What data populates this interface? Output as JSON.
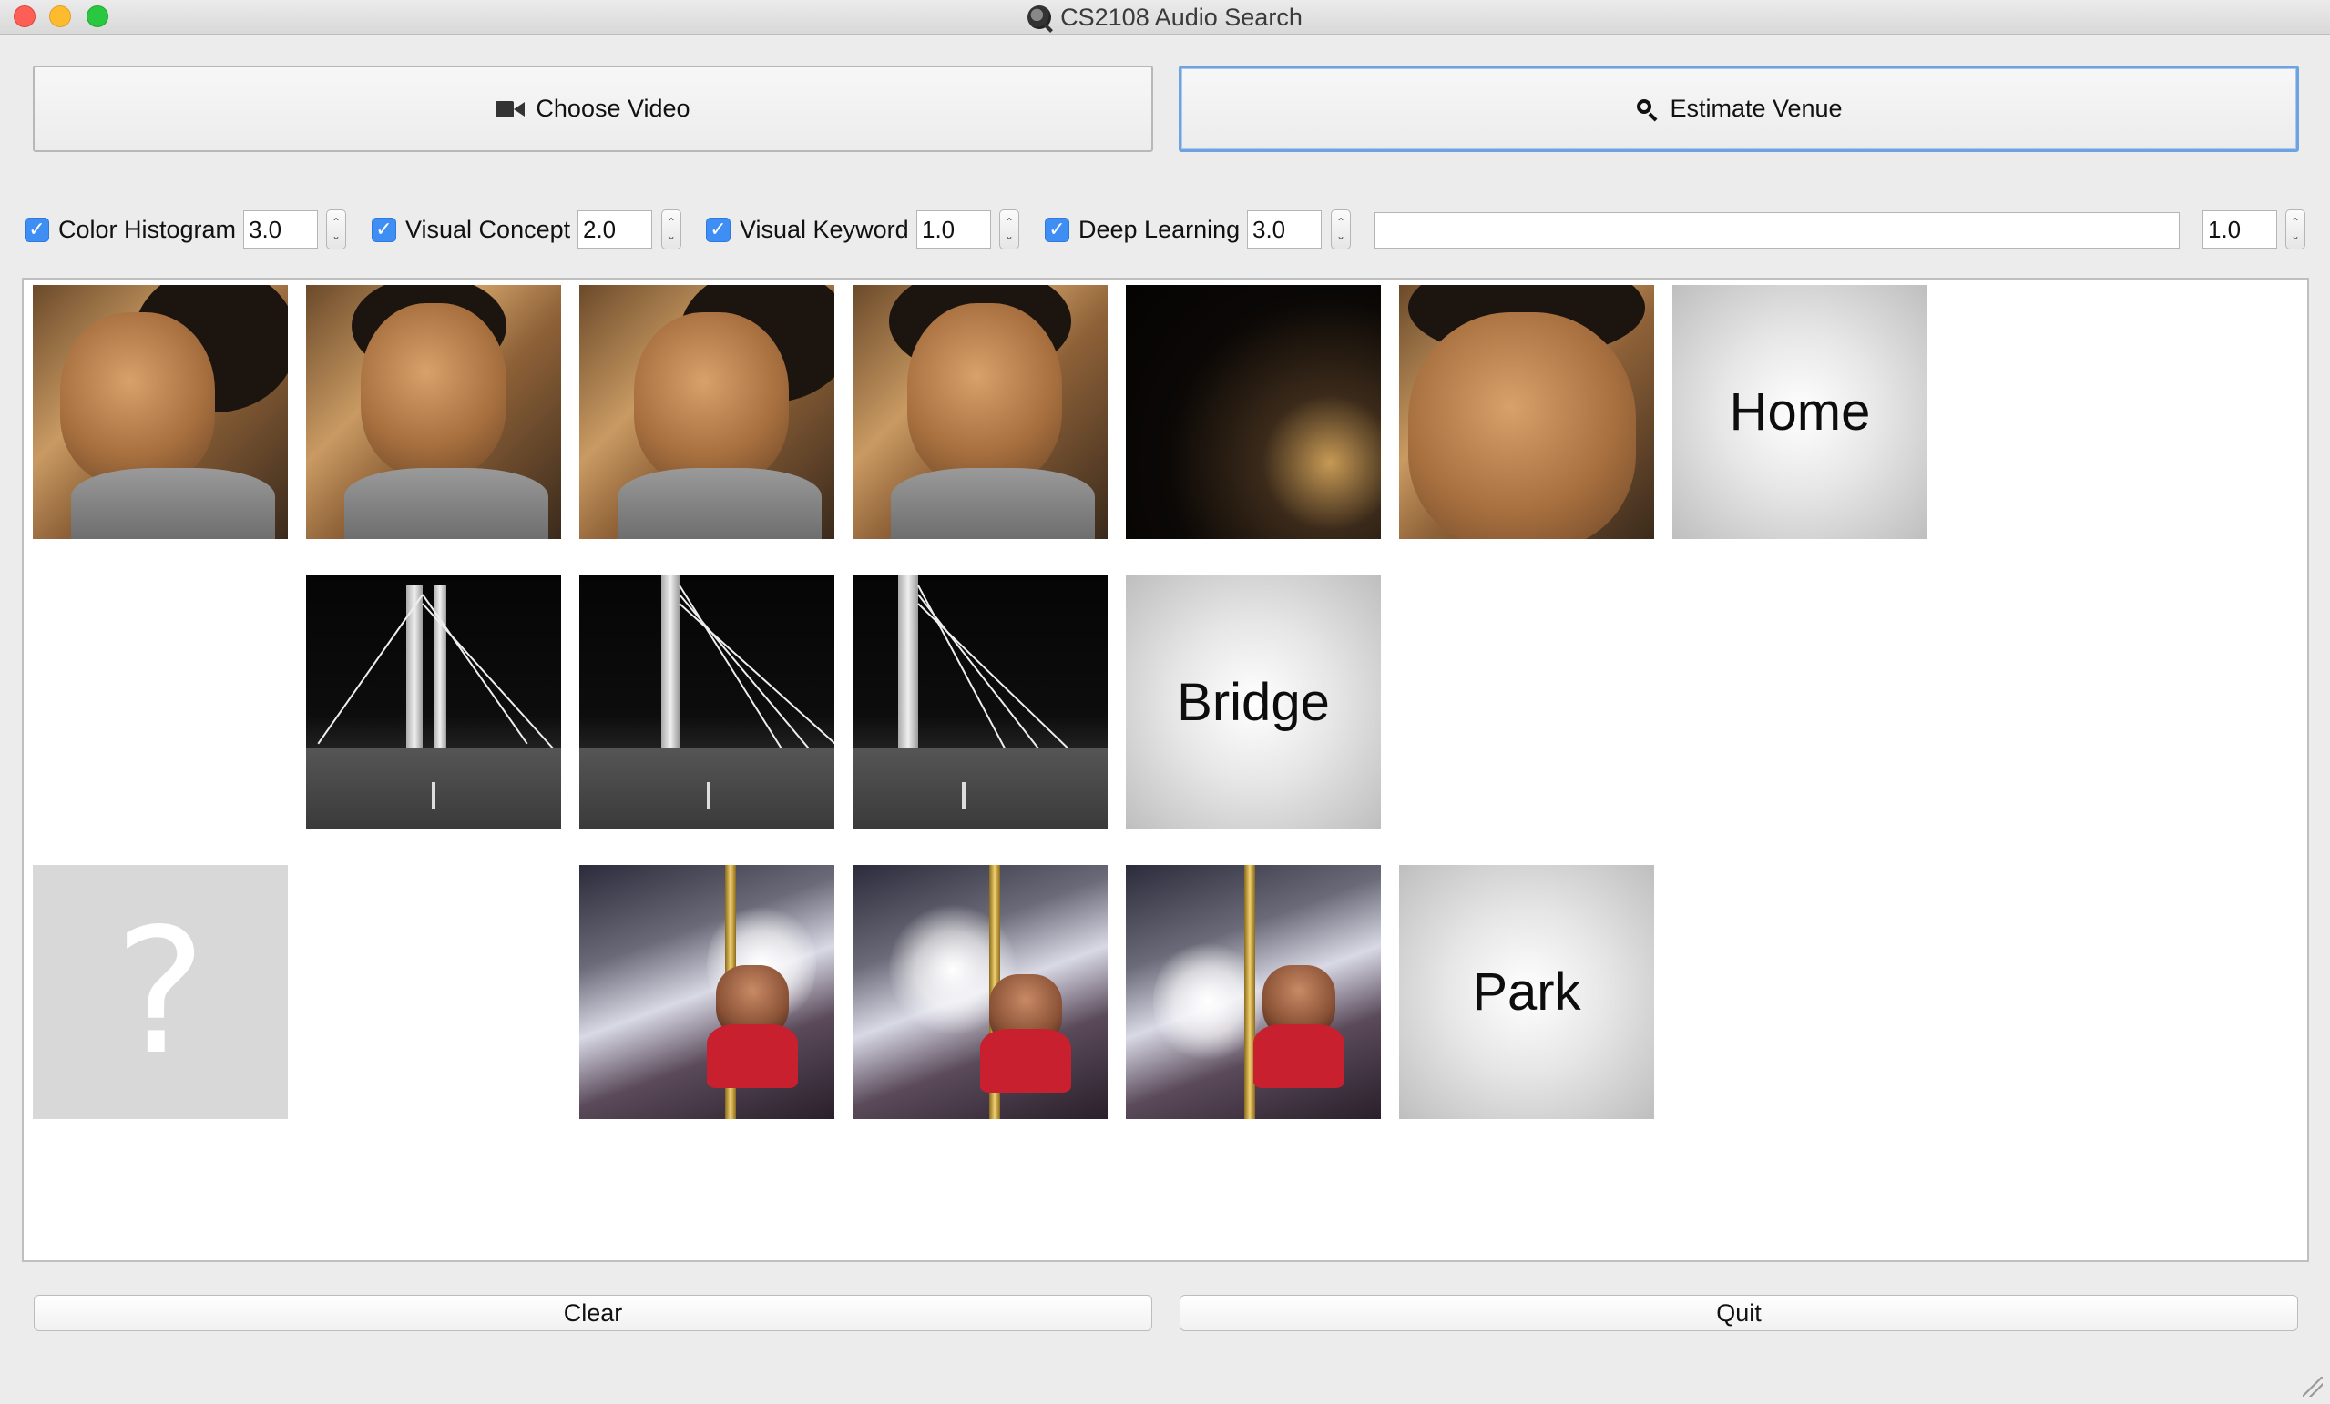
{
  "window": {
    "title": "CS2108 Audio Search"
  },
  "toolbar": {
    "choose_video_label": "Choose Video",
    "estimate_venue_label": "Estimate Venue"
  },
  "features": [
    {
      "label": "Color Histogram",
      "checked": true,
      "weight": "3.0"
    },
    {
      "label": "Visual Concept",
      "checked": true,
      "weight": "2.0"
    },
    {
      "label": "Visual Keyword",
      "checked": true,
      "weight": "1.0"
    },
    {
      "label": "Deep Learning",
      "checked": true,
      "weight": "3.0"
    }
  ],
  "extra_input": {
    "value": "",
    "weight": "1.0"
  },
  "results": {
    "rows": [
      {
        "frames": [
          "face",
          "face",
          "face",
          "face",
          "dark",
          "face"
        ],
        "venue": "Home"
      },
      {
        "frames": [
          "bridge",
          "bridge",
          "bridge"
        ],
        "venue": "Bridge"
      },
      {
        "frames": [
          "carousel",
          "carousel",
          "carousel"
        ],
        "venue": "Park"
      }
    ],
    "unknown_glyph": "?"
  },
  "footer": {
    "clear_label": "Clear",
    "quit_label": "Quit"
  },
  "colors": {
    "checkbox": "#3f8ef4",
    "focus_ring": "#6fa3e0",
    "close": "#fd5f57",
    "minimize": "#febb2e",
    "maximize": "#29c840"
  }
}
